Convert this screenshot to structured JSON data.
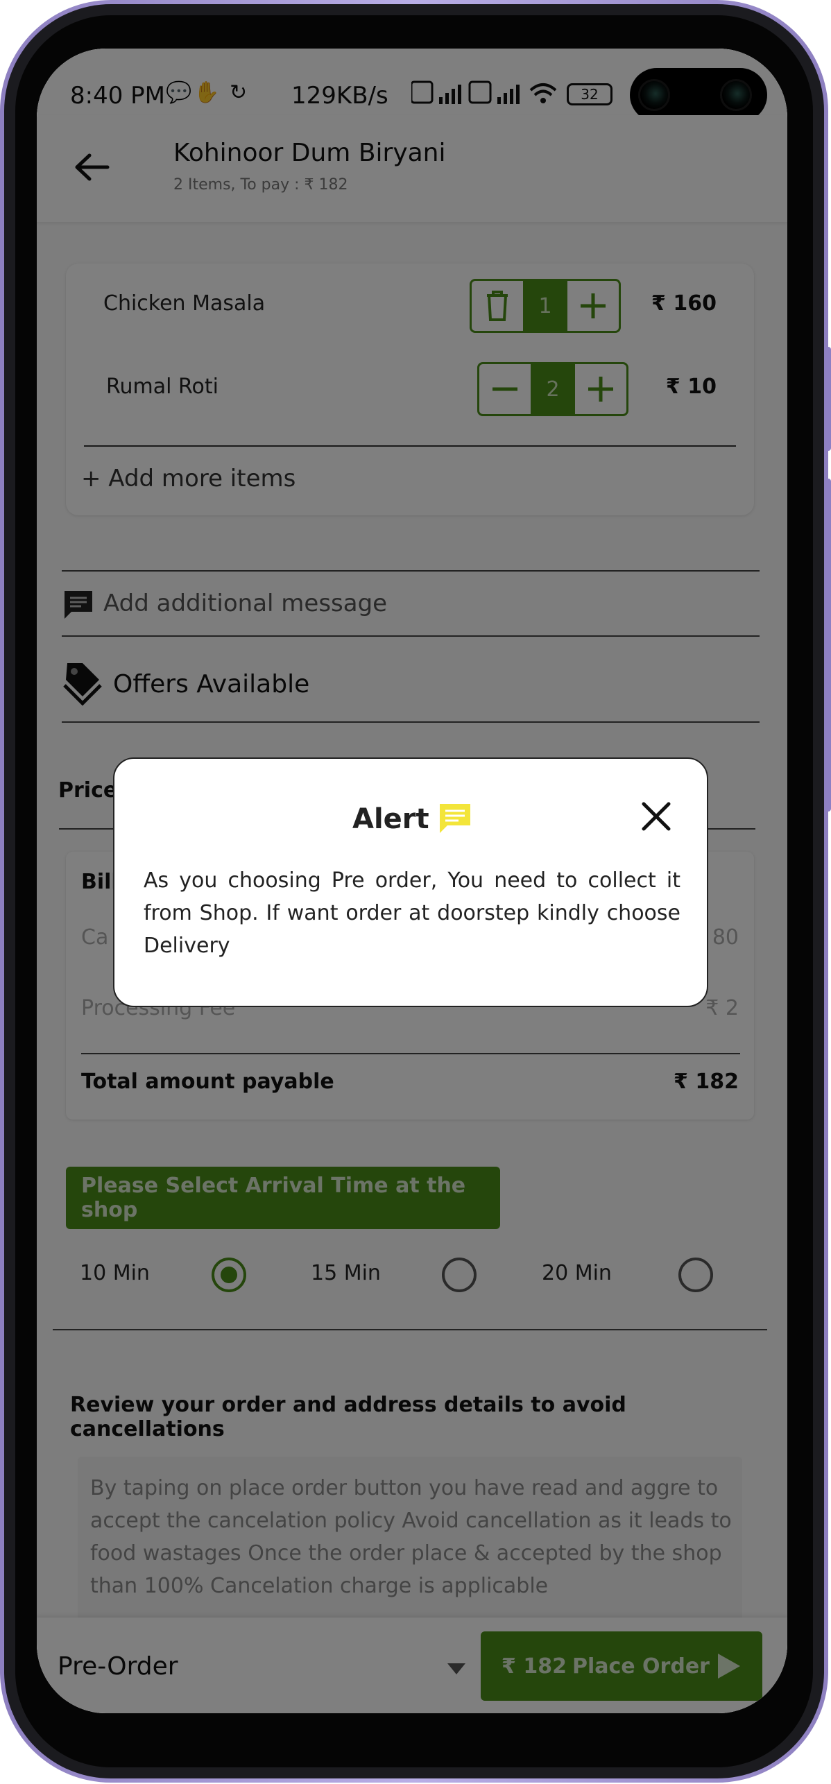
{
  "status_bar": {
    "time": "8:40 PM",
    "network_speed": "129KB/s",
    "battery": "32"
  },
  "header": {
    "title": "Kohinoor Dum Biryani",
    "subtitle": "2 Items,  To pay : ₹ 182"
  },
  "cart": {
    "items": [
      {
        "name": "Chicken  Masala",
        "quantity": "1",
        "price": "₹ 160"
      },
      {
        "name": "Rumal Roti",
        "quantity": "2",
        "price": "₹ 10"
      }
    ],
    "add_more_label": "+ Add more items"
  },
  "message": {
    "placeholder": "Add additional message"
  },
  "offers": {
    "label": "Offers Available"
  },
  "price_section": {
    "label": "Price",
    "bill_title": "Bill",
    "rows": [
      {
        "label": "Ca",
        "value": "80"
      },
      {
        "label": "Processing Fee",
        "value": "₹ 2"
      }
    ],
    "total_label": "Total amount payable",
    "total_value": "₹  182"
  },
  "arrival": {
    "button_label": "Please Select Arrival Time at the shop",
    "options": [
      {
        "label": "10 Min",
        "selected": true
      },
      {
        "label": "15 Min",
        "selected": false
      },
      {
        "label": "20 Min",
        "selected": false
      }
    ]
  },
  "review": {
    "heading": "Review your order and address details to avoid cancellations",
    "policy_text": "By taping on place order button you have read and aggre to accept the cancelation policy Avoid cancellation as it leads to food wastages  Once the order place &  accepted by the shop  than 100% Cancelation charge is applicable"
  },
  "bottom_bar": {
    "order_type": "Pre-Order",
    "place_order_amount": "₹ 182",
    "place_order_label": "Place Order"
  },
  "alert": {
    "title": "Alert",
    "body": "As you choosing Pre order, You need to collect it from Shop. If want order at doorstep kindly choose Delivery"
  },
  "colors": {
    "brand_green": "#4a8d18",
    "alert_icon_yellow": "#f3e53a",
    "frame_purple": "#8d7fc0"
  },
  "icons": [
    "back-arrow-icon",
    "trash-icon",
    "plus-icon",
    "minus-icon",
    "chat-icon",
    "tag-icon",
    "dropdown-icon",
    "play-icon",
    "close-icon"
  ]
}
